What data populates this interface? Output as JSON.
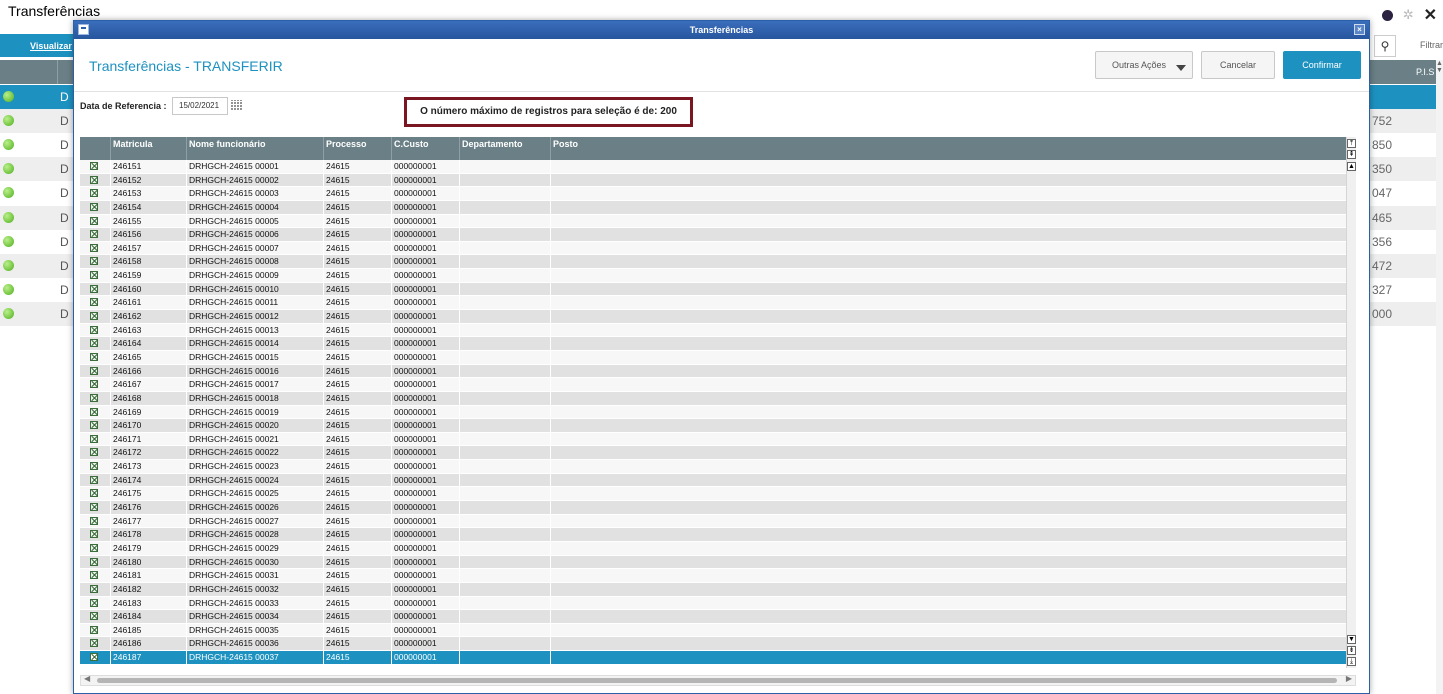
{
  "app": {
    "title": "Transferências",
    "visualizar_label": "Visualizar",
    "filtrar_label": "Filtrar",
    "pis_header": "P.I.S",
    "rows": [
      {
        "text": "D I",
        "value": ""
      },
      {
        "text": "D I",
        "value": "752"
      },
      {
        "text": "D I",
        "value": "850"
      },
      {
        "text": "D I",
        "value": "350"
      },
      {
        "text": "D I",
        "value": "047"
      },
      {
        "text": "D I",
        "value": "465"
      },
      {
        "text": "D I",
        "value": "356"
      },
      {
        "text": "D I",
        "value": "472"
      },
      {
        "text": "D I",
        "value": "327"
      },
      {
        "text": "D I",
        "value": "000"
      }
    ]
  },
  "modal": {
    "window_title": "Transferências",
    "page_title": "Transferências - TRANSFERIR",
    "buttons": {
      "outras": "Outras Ações",
      "cancelar": "Cancelar",
      "confirmar": "Confirmar"
    },
    "date_label": "Data de Referencia :",
    "date_value": "15/02/2021",
    "warning": "O número máximo de registros para seleção é de: 200",
    "accent_color": "#1d92c0",
    "warning_border_color": "#7a1622",
    "grid": {
      "headers": [
        "Matricula",
        "Nome funcionário",
        "Processo",
        "C.Custo",
        "Departamento",
        "Posto"
      ],
      "rows": [
        [
          "246151",
          "DRHGCH-24615 00001",
          "24615",
          "000000001"
        ],
        [
          "246152",
          "DRHGCH-24615 00002",
          "24615",
          "000000001"
        ],
        [
          "246153",
          "DRHGCH-24615 00003",
          "24615",
          "000000001"
        ],
        [
          "246154",
          "DRHGCH-24615 00004",
          "24615",
          "000000001"
        ],
        [
          "246155",
          "DRHGCH-24615 00005",
          "24615",
          "000000001"
        ],
        [
          "246156",
          "DRHGCH-24615 00006",
          "24615",
          "000000001"
        ],
        [
          "246157",
          "DRHGCH-24615 00007",
          "24615",
          "000000001"
        ],
        [
          "246158",
          "DRHGCH-24615 00008",
          "24615",
          "000000001"
        ],
        [
          "246159",
          "DRHGCH-24615 00009",
          "24615",
          "000000001"
        ],
        [
          "246160",
          "DRHGCH-24615 00010",
          "24615",
          "000000001"
        ],
        [
          "246161",
          "DRHGCH-24615 00011",
          "24615",
          "000000001"
        ],
        [
          "246162",
          "DRHGCH-24615 00012",
          "24615",
          "000000001"
        ],
        [
          "246163",
          "DRHGCH-24615 00013",
          "24615",
          "000000001"
        ],
        [
          "246164",
          "DRHGCH-24615 00014",
          "24615",
          "000000001"
        ],
        [
          "246165",
          "DRHGCH-24615 00015",
          "24615",
          "000000001"
        ],
        [
          "246166",
          "DRHGCH-24615 00016",
          "24615",
          "000000001"
        ],
        [
          "246167",
          "DRHGCH-24615 00017",
          "24615",
          "000000001"
        ],
        [
          "246168",
          "DRHGCH-24615 00018",
          "24615",
          "000000001"
        ],
        [
          "246169",
          "DRHGCH-24615 00019",
          "24615",
          "000000001"
        ],
        [
          "246170",
          "DRHGCH-24615 00020",
          "24615",
          "000000001"
        ],
        [
          "246171",
          "DRHGCH-24615 00021",
          "24615",
          "000000001"
        ],
        [
          "246172",
          "DRHGCH-24615 00022",
          "24615",
          "000000001"
        ],
        [
          "246173",
          "DRHGCH-24615 00023",
          "24615",
          "000000001"
        ],
        [
          "246174",
          "DRHGCH-24615 00024",
          "24615",
          "000000001"
        ],
        [
          "246175",
          "DRHGCH-24615 00025",
          "24615",
          "000000001"
        ],
        [
          "246176",
          "DRHGCH-24615 00026",
          "24615",
          "000000001"
        ],
        [
          "246177",
          "DRHGCH-24615 00027",
          "24615",
          "000000001"
        ],
        [
          "246178",
          "DRHGCH-24615 00028",
          "24615",
          "000000001"
        ],
        [
          "246179",
          "DRHGCH-24615 00029",
          "24615",
          "000000001"
        ],
        [
          "246180",
          "DRHGCH-24615 00030",
          "24615",
          "000000001"
        ],
        [
          "246181",
          "DRHGCH-24615 00031",
          "24615",
          "000000001"
        ],
        [
          "246182",
          "DRHGCH-24615 00032",
          "24615",
          "000000001"
        ],
        [
          "246183",
          "DRHGCH-24615 00033",
          "24615",
          "000000001"
        ],
        [
          "246184",
          "DRHGCH-24615 00034",
          "24615",
          "000000001"
        ],
        [
          "246185",
          "DRHGCH-24615 00035",
          "24615",
          "000000001"
        ],
        [
          "246186",
          "DRHGCH-24615 00036",
          "24615",
          "000000001"
        ],
        [
          "246187",
          "DRHGCH-24615 00037",
          "24615",
          "000000001"
        ]
      ],
      "selected_index": 36
    }
  }
}
